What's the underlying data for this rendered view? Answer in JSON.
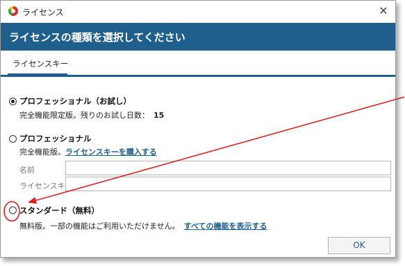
{
  "window": {
    "title": "ライセンス",
    "close_glyph": "✕"
  },
  "header": {
    "title": "ライセンスの種類を選択してください"
  },
  "tabs": [
    {
      "label": "ライセンスキー",
      "active": true
    }
  ],
  "options": {
    "trial": {
      "title": "プロフェッショナル（お試し）",
      "desc_prefix": "完全機能限定版。残りのお試し日数：",
      "days": "15",
      "selected": true
    },
    "pro": {
      "title": "プロフェッショナル",
      "desc_prefix": "完全機能版。",
      "link": "ライセンスキーを購入する",
      "selected": false,
      "fields": {
        "name_label": "名前",
        "name_value": "",
        "key_label": "ライセンスキー",
        "key_value": ""
      }
    },
    "standard": {
      "title": "スタンダード（無料）",
      "desc_prefix": "無料版。一部の機能はご利用いただけません。",
      "link": "すべての機能を表示する",
      "selected": false
    }
  },
  "buttons": {
    "ok": "OK"
  },
  "annotation": {
    "color": "#e02020"
  },
  "colors": {
    "accent": "#1e5f8e"
  }
}
